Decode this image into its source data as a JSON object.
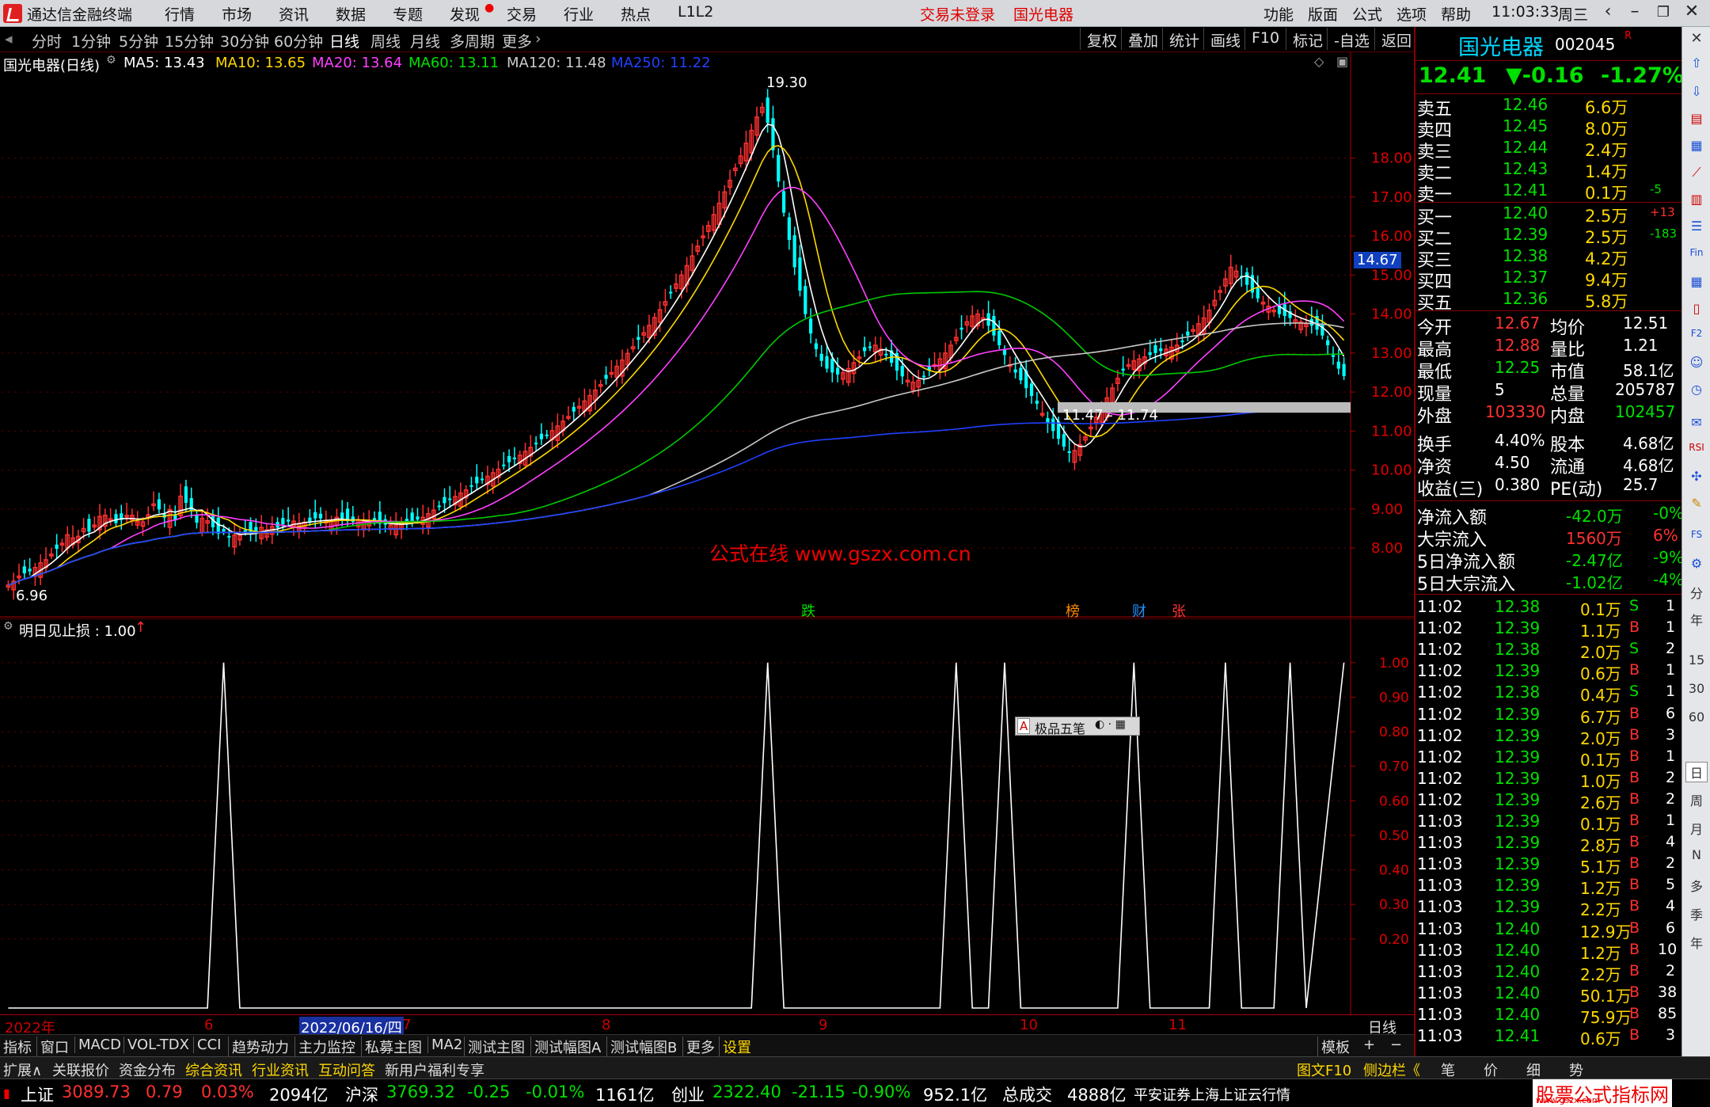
{
  "titlebar": {
    "app": "通达信金融终端",
    "menus": [
      "行情",
      "市场",
      "资讯",
      "数据",
      "专题",
      "发现",
      "交易",
      "行业",
      "热点",
      "L1L2"
    ],
    "login": "交易未登录",
    "stock": "国光电器",
    "right_menus": [
      "功能",
      "版面",
      "公式",
      "选项",
      "帮助"
    ],
    "time": "11:03:33",
    "weekday": "周三"
  },
  "period": {
    "items": [
      "分时",
      "1分钟",
      "5分钟",
      "15分钟",
      "30分钟",
      "60分钟",
      "日线",
      "周线",
      "月线",
      "多周期",
      "更多"
    ],
    "active": "日线",
    "tools": [
      "复权",
      "叠加",
      "统计",
      "画线",
      "F10",
      "标记",
      "-自选",
      "返回"
    ]
  },
  "legend": {
    "name": "国光电器(日线)",
    "ma5": "MA5: 13.43",
    "ma10": "MA10: 13.65",
    "ma20": "MA20: 13.64",
    "ma60": "MA60: 13.11",
    "ma120": "MA120: 11.48",
    "ma250": "MA250: 11.22"
  },
  "sub_legend": "明日见止损 : 1.00",
  "annotations": {
    "high": "19.30",
    "low": "6.96",
    "range": "11.47 - 11.74",
    "current": "14.67",
    "watermark": "公式在线  www.gszx.com.cn",
    "ime": "极品五笔"
  },
  "events": [
    {
      "text": "跌",
      "color": "#00e000"
    },
    {
      "text": "榜",
      "color": "#ff8c00"
    },
    {
      "text": "财",
      "color": "#1e90ff"
    },
    {
      "text": "张",
      "color": "#ff3030"
    }
  ],
  "colors": {
    "up": "#ff3030",
    "down": "#00ffff",
    "ma5": "#ffffff",
    "ma10": "#ffd800",
    "ma20": "#ff40ff",
    "ma60": "#00c800",
    "ma120": "#c8c8c8",
    "ma250": "#2040ff"
  },
  "chart_data": [
    {
      "type": "candlestick",
      "title": "国光电器(日线)",
      "ylim": [
        6.5,
        19.9
      ],
      "yticks": [
        8.0,
        9.0,
        10.0,
        11.0,
        12.0,
        13.0,
        14.0,
        15.0,
        16.0,
        17.0,
        18.0
      ],
      "x": [
        "2022年",
        "6",
        "2022/06/16/四",
        "7",
        "8",
        "9",
        "10",
        "11",
        "日线"
      ],
      "close": [
        7.05,
        7.15,
        7.28,
        7.35,
        7.4,
        7.5,
        7.62,
        7.7,
        7.84,
        7.98,
        8.12,
        8.34,
        8.26,
        8.3,
        8.5,
        8.42,
        8.59,
        8.81,
        8.84,
        8.75,
        8.64,
        8.72,
        8.84,
        8.84,
        8.68,
        8.67,
        8.85,
        9.13,
        8.99,
        8.78,
        8.99,
        8.71,
        9.33,
        9.16,
        8.97,
        8.65,
        8.76,
        8.7,
        8.53,
        8.37,
        8.43,
        8.28,
        8.33,
        8.34,
        8.42,
        8.42,
        8.36,
        8.53,
        8.47,
        8.55,
        8.52,
        8.61,
        8.68,
        8.69,
        8.63,
        8.66,
        8.67,
        8.76,
        8.76,
        8.69,
        8.71,
        8.79,
        8.76,
        8.69,
        8.67,
        8.72,
        8.69,
        8.65,
        8.68,
        8.62,
        8.6,
        8.59,
        8.6,
        8.63,
        8.66,
        8.69,
        8.73,
        8.79,
        8.88,
        8.97,
        9.06,
        9.15,
        9.23,
        9.32,
        9.41,
        9.49,
        9.58,
        9.66,
        9.75,
        9.84,
        9.93,
        10.02,
        10.11,
        10.2,
        10.29,
        10.38,
        10.48,
        10.58,
        10.68,
        10.79,
        10.9,
        11.01,
        11.13,
        11.25,
        11.37,
        11.5,
        11.63,
        11.77,
        11.91,
        12.05,
        12.19,
        12.34,
        12.5,
        12.66,
        12.82,
        12.99,
        13.16,
        13.34,
        13.52,
        13.71,
        13.91,
        14.11,
        14.32,
        14.54,
        14.77,
        15.0,
        15.24,
        15.49,
        15.74,
        16.0,
        16.27,
        16.55,
        16.84,
        17.13,
        17.43,
        17.74,
        18.05,
        18.38,
        18.71,
        19.05,
        19.3,
        18.9,
        18.2,
        17.4,
        16.6,
        15.9,
        15.2,
        14.6,
        14.0,
        13.5,
        13.1,
        12.8,
        12.6,
        12.5,
        12.45,
        12.5,
        12.6,
        12.75,
        12.9,
        13.05,
        13.15,
        13.2,
        13.1,
        12.95,
        12.75,
        12.55,
        12.4,
        12.3,
        12.25,
        12.3,
        12.4,
        12.55,
        12.7,
        12.85,
        13.0,
        13.2,
        13.4,
        13.6,
        13.8,
        13.95,
        14.0,
        13.9,
        13.7,
        13.45,
        13.2,
        12.95,
        12.7,
        12.5,
        12.3,
        12.1,
        11.9,
        11.7,
        11.45,
        11.2,
        11.0,
        10.8,
        10.6,
        10.45,
        10.5,
        10.65,
        10.85,
        11.1,
        11.35,
        11.6,
        11.85,
        12.1,
        12.35,
        12.55,
        12.7,
        12.8,
        12.85,
        12.9,
        12.95,
        13.0,
        13.05,
        13.1,
        13.15,
        13.2,
        13.3,
        13.45,
        13.6,
        13.75,
        13.9,
        14.1,
        14.35,
        14.6,
        14.9,
        15.2,
        15.1,
        14.95,
        14.75,
        14.55,
        14.4,
        14.3,
        14.2,
        14.1,
        14.0,
        13.95,
        13.9,
        13.85,
        13.8,
        13.75,
        13.7,
        13.6,
        13.45,
        13.2,
        12.9,
        12.6,
        12.41
      ]
    },
    {
      "type": "line",
      "title": "明日见止损",
      "ylim": [
        0.0,
        1.05
      ],
      "yticks": [
        0.2,
        0.3,
        0.4,
        0.5,
        0.6,
        0.7,
        0.8,
        0.9,
        1.0
      ],
      "spikes_at_bar": [
        40,
        141,
        176,
        185,
        209,
        226,
        238
      ],
      "current": "1.00"
    }
  ],
  "quote": {
    "name": "国光电器",
    "code": "002045",
    "price": "12.41",
    "change": "▼-0.16",
    "pct": "-1.27%",
    "asks": [
      [
        "卖五",
        "12.46",
        "6.6万",
        ""
      ],
      [
        "卖四",
        "12.45",
        "8.0万",
        ""
      ],
      [
        "卖三",
        "12.44",
        "2.4万",
        ""
      ],
      [
        "卖二",
        "12.43",
        "1.4万",
        ""
      ],
      [
        "卖一",
        "12.41",
        "0.1万",
        "-5"
      ]
    ],
    "bids": [
      [
        "买一",
        "12.40",
        "2.5万",
        "+13"
      ],
      [
        "买二",
        "12.39",
        "2.5万",
        "-183"
      ],
      [
        "买三",
        "12.38",
        "4.2万",
        ""
      ],
      [
        "买四",
        "12.37",
        "9.4万",
        ""
      ],
      [
        "买五",
        "12.36",
        "5.8万",
        ""
      ]
    ],
    "stats": [
      [
        "今开",
        "12.67",
        "均价",
        "12.51"
      ],
      [
        "最高",
        "12.88",
        "量比",
        "1.21"
      ],
      [
        "最低",
        "12.25",
        "市值",
        "58.1亿"
      ],
      [
        "现量",
        "5",
        "总量",
        "205787"
      ],
      [
        "外盘",
        "103330",
        "内盘",
        "102457"
      ],
      [
        "换手",
        "4.40%",
        "股本",
        "4.68亿"
      ],
      [
        "净资",
        "4.50",
        "流通",
        "4.68亿"
      ],
      [
        "收益(三)",
        "0.380",
        "PE(动)",
        "25.7"
      ]
    ],
    "flows": [
      [
        "净流入额",
        "-42.0万",
        "-0%"
      ],
      [
        "大宗流入",
        "1560万",
        "6%"
      ],
      [
        "5日净流入额",
        "-2.47亿",
        "-9%"
      ],
      [
        "5日大宗流入",
        "-1.02亿",
        "-4%"
      ]
    ],
    "ticks": [
      [
        "11:02",
        "12.38",
        "0.1万",
        "S",
        "1"
      ],
      [
        "11:02",
        "12.39",
        "1.1万",
        "B",
        "1"
      ],
      [
        "11:02",
        "12.38",
        "2.0万",
        "S",
        "2"
      ],
      [
        "11:02",
        "12.39",
        "0.6万",
        "B",
        "1"
      ],
      [
        "11:02",
        "12.38",
        "0.4万",
        "S",
        "1"
      ],
      [
        "11:02",
        "12.39",
        "6.7万",
        "B",
        "6"
      ],
      [
        "11:02",
        "12.39",
        "2.0万",
        "B",
        "3"
      ],
      [
        "11:02",
        "12.39",
        "0.1万",
        "B",
        "1"
      ],
      [
        "11:02",
        "12.39",
        "1.0万",
        "B",
        "2"
      ],
      [
        "11:02",
        "12.39",
        "2.6万",
        "B",
        "2"
      ],
      [
        "11:03",
        "12.39",
        "0.1万",
        "B",
        "1"
      ],
      [
        "11:03",
        "12.39",
        "2.8万",
        "B",
        "4"
      ],
      [
        "11:03",
        "12.39",
        "5.1万",
        "B",
        "2"
      ],
      [
        "11:03",
        "12.39",
        "1.2万",
        "B",
        "5"
      ],
      [
        "11:03",
        "12.39",
        "2.2万",
        "B",
        "4"
      ],
      [
        "11:03",
        "12.40",
        "12.9万",
        "B",
        "6"
      ],
      [
        "11:03",
        "12.40",
        "1.2万",
        "B",
        "10"
      ],
      [
        "11:03",
        "12.40",
        "2.2万",
        "B",
        "2"
      ],
      [
        "11:03",
        "12.40",
        "50.1万",
        "B",
        "38"
      ],
      [
        "11:03",
        "12.40",
        "75.9万",
        "B",
        "85"
      ],
      [
        "11:03",
        "12.41",
        "0.6万",
        "B",
        "3"
      ]
    ]
  },
  "tabs": [
    "指标",
    "窗口",
    "MACD",
    "VOL-TDX",
    "CCI",
    "趋势动力",
    "主力监控",
    "私募主图",
    "MA2",
    "测试主图",
    "测试幅图A",
    "测试幅图B",
    "更多",
    "设置"
  ],
  "tabs_right": [
    "模板",
    "+",
    "−"
  ],
  "bottom_links": [
    "扩展∧",
    "关联报价",
    "资金分布",
    "综合资讯",
    "行业资讯",
    "互动问答",
    "新用户福利专享"
  ],
  "bottom_right": [
    "图文F10",
    "侧边栏《",
    "笔",
    "价",
    "细",
    "势"
  ],
  "status": {
    "sh_name": "上证",
    "sh_val": "3089.73",
    "sh_chg": "0.79",
    "sh_pct": "0.03%",
    "sh_amt": "2094亿",
    "hs_name": "沪深",
    "hs_val": "3769.32",
    "hs_chg": "-0.25",
    "hs_pct": "-0.01%",
    "hs_amt": "1161亿",
    "cy_name": "创业",
    "cy_val": "2322.40",
    "cy_chg": "-21.15",
    "cy_pct": "-0.90%",
    "cy_amt": "952.1亿",
    "total_name": "总成交",
    "total_amt": "4888亿",
    "server": "平安证券上海上证云行情",
    "brand": "股票公式指标网",
    "brand_url": "www.gszx.com"
  },
  "sidebar_labels": [
    "分",
    "周",
    "月",
    "多",
    "季",
    "年",
    "15",
    "30",
    "60",
    "日",
    "周",
    "月",
    "N",
    "多",
    "季",
    "年"
  ]
}
